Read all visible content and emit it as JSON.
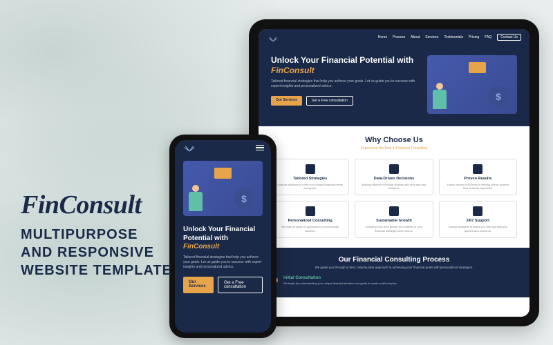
{
  "promo": {
    "brand": "FinConsult",
    "tagline_l1": "MULTIPURPOSE",
    "tagline_l2": "AND RESPONSIVE",
    "tagline_l3": "WEBSITE TEMPLATE"
  },
  "nav": {
    "items": [
      "Home",
      "Process",
      "About",
      "Services",
      "Testimonials",
      "Pricing",
      "FAQ"
    ],
    "contact": "Contact Us"
  },
  "hero": {
    "title_prefix": "Unlock Your Financial Potential with ",
    "title_accent": "FinConsult",
    "subtitle": "Tailored financial strategies that help you achieve your goals. Let us guide you to success with expert insights and personalized advice.",
    "btn_primary": "Our Services",
    "btn_outline": "Get a Free consultation"
  },
  "why": {
    "title": "Why Choose Us",
    "subtitle": "Experience the Best in Financial Consulting",
    "cards": [
      {
        "title": "Tailored Strategies",
        "desc": "Custom solutions to meet your unique financial needs and goals."
      },
      {
        "title": "Data-Driven Decisions",
        "desc": "Making informed financial choices with real data and analytics."
      },
      {
        "title": "Proven Results",
        "desc": "A track record of success in helping clients achieve their financial objectives."
      },
      {
        "title": "Personalized Consulting",
        "desc": "We take a hands-on approach to your financial success."
      },
      {
        "title": "Sustainable Growth",
        "desc": "Ensuring long-term growth and stability in your financial strategies and returns."
      },
      {
        "title": "24/7 Support",
        "desc": "Always available to assist you with any financial queries and concerns."
      }
    ]
  },
  "process": {
    "title": "Our Financial Consulting Process",
    "subtitle": "We guide you through a clear, step-by-step approach to achieving your financial goals with personalized strategies.",
    "step": {
      "title": "Initial Consultation",
      "desc": "We begin by understanding your unique financial situation and goals to create a tailored plan."
    }
  },
  "phone_hero": {
    "subtitle": "Tailored financial strategies that help you achieve your goals. Let us guide you to success with expert insights and personalized advice.",
    "btn_primary": "Our Services",
    "btn_outline": "Get a Free consultation"
  }
}
